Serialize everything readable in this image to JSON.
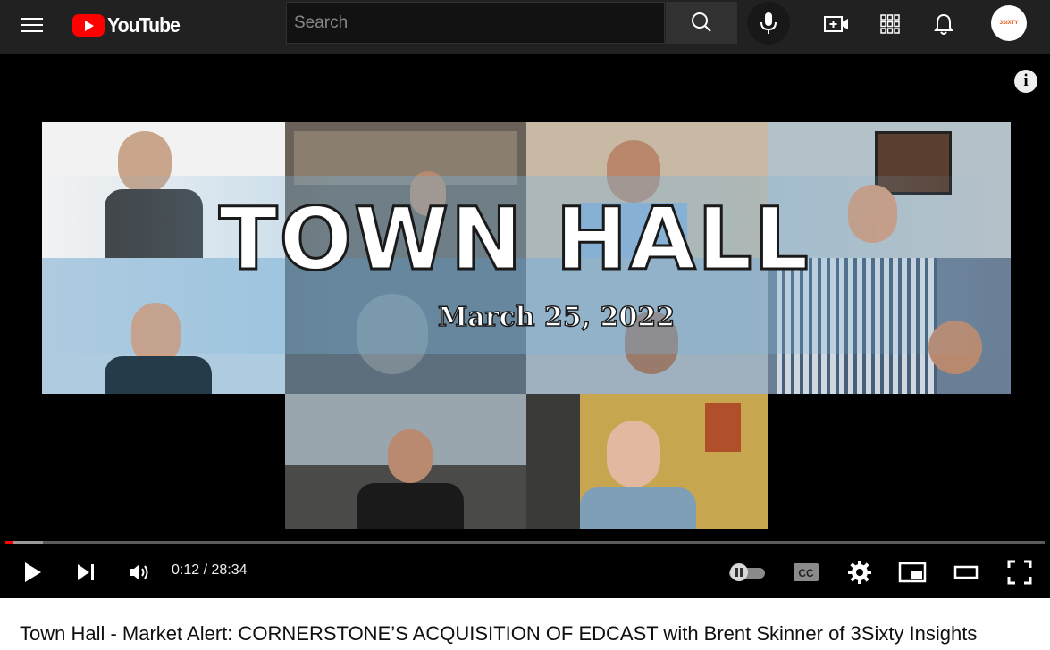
{
  "header": {
    "logo_text": "YouTube",
    "search_placeholder": "Search",
    "icons": [
      "menu-icon",
      "search-icon",
      "mic-icon",
      "create-video-icon",
      "apps-grid-icon",
      "notifications-bell-icon",
      "avatar"
    ]
  },
  "video": {
    "thumbnail_title": "TOWN HALL",
    "thumbnail_date": "March 25, 2022",
    "info_label": "i",
    "current_time": "0:12",
    "duration": "28:34",
    "time_display": "0:12 / 28:34",
    "played_fraction": 0.007,
    "buffered_fraction": 0.036,
    "controls": [
      "play-icon",
      "next-icon",
      "volume-icon",
      "autoplay-toggle",
      "cc-icon",
      "settings-icon",
      "miniplayer-icon",
      "theater-icon",
      "fullscreen-icon"
    ],
    "colors": {
      "progress": "#ff0000",
      "brand": "#ff0000"
    }
  },
  "page": {
    "video_title": "Town Hall - Market Alert: CORNERSTONE’S ACQUISITION OF EDCAST with Brent Skinner of 3Sixty Insights"
  }
}
